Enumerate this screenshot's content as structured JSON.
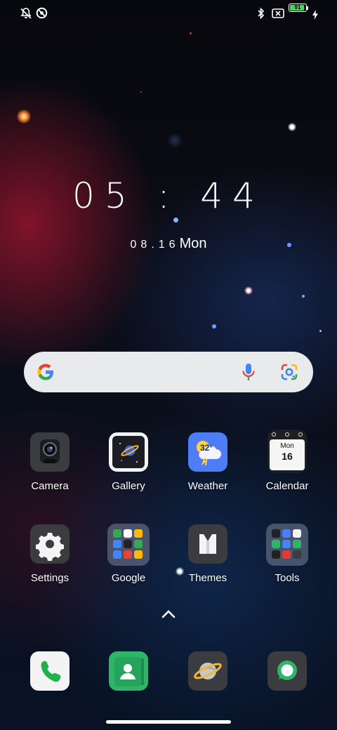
{
  "status_bar": {
    "left_icons": [
      "notifications-off-icon",
      "data-saver-icon"
    ],
    "right_icons": [
      "bluetooth-icon",
      "no-sim-icon",
      "battery-icon",
      "charging-bolt-icon"
    ],
    "battery_level": "91",
    "battery_percent": 91
  },
  "lockscreen": {
    "time": "05 : 44",
    "date_numeric": "08.16",
    "weekday": "Mon"
  },
  "search_bar": {
    "icons": [
      "google-g-icon",
      "microphone-icon",
      "google-lens-icon"
    ]
  },
  "home": {
    "row1": [
      {
        "label": "Camera",
        "icon": "camera-icon"
      },
      {
        "label": "Gallery",
        "icon": "gallery-icon"
      },
      {
        "label": "Weather",
        "icon": "weather-icon",
        "temp": "32°"
      },
      {
        "label": "Calendar",
        "icon": "calendar-icon",
        "cal_month": "Mon",
        "cal_day": "16"
      }
    ],
    "row2": [
      {
        "label": "Settings",
        "icon": "settings-gear-icon"
      },
      {
        "label": "Google",
        "icon": "google-folder-icon"
      },
      {
        "label": "Themes",
        "icon": "themes-icon"
      },
      {
        "label": "Tools",
        "icon": "tools-folder-icon"
      }
    ]
  },
  "app_drawer_icon": "chevron-up-icon",
  "dock": [
    {
      "icon": "phone-icon"
    },
    {
      "icon": "contacts-icon"
    },
    {
      "icon": "browser-icon"
    },
    {
      "icon": "messages-icon"
    }
  ],
  "colors": {
    "accent_blue": "#4f7df7",
    "battery_green": "#3ddc5a",
    "search_bar": "#e9eaec",
    "contacts_green": "#2fb56a"
  }
}
